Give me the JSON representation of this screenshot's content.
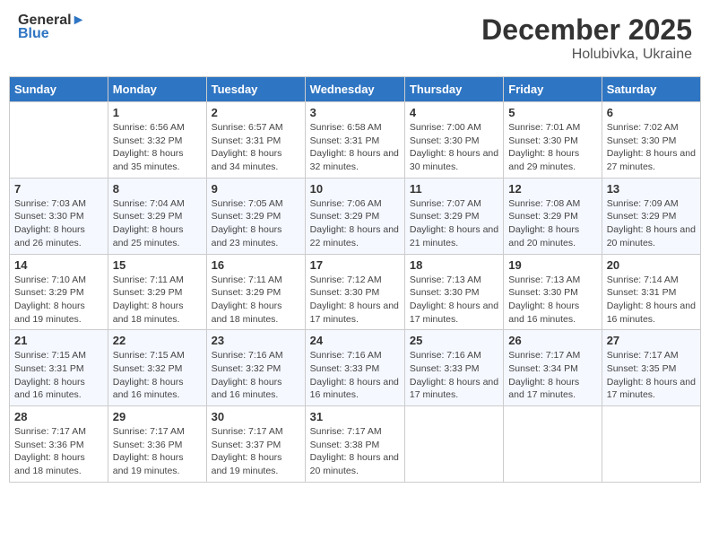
{
  "header": {
    "logo_line1": "General",
    "logo_line2": "Blue",
    "month": "December 2025",
    "location": "Holubivka, Ukraine"
  },
  "weekdays": [
    "Sunday",
    "Monday",
    "Tuesday",
    "Wednesday",
    "Thursday",
    "Friday",
    "Saturday"
  ],
  "weeks": [
    [
      {
        "day": "",
        "sunrise": "",
        "sunset": "",
        "daylight": ""
      },
      {
        "day": "1",
        "sunrise": "Sunrise: 6:56 AM",
        "sunset": "Sunset: 3:32 PM",
        "daylight": "Daylight: 8 hours and 35 minutes."
      },
      {
        "day": "2",
        "sunrise": "Sunrise: 6:57 AM",
        "sunset": "Sunset: 3:31 PM",
        "daylight": "Daylight: 8 hours and 34 minutes."
      },
      {
        "day": "3",
        "sunrise": "Sunrise: 6:58 AM",
        "sunset": "Sunset: 3:31 PM",
        "daylight": "Daylight: 8 hours and 32 minutes."
      },
      {
        "day": "4",
        "sunrise": "Sunrise: 7:00 AM",
        "sunset": "Sunset: 3:30 PM",
        "daylight": "Daylight: 8 hours and 30 minutes."
      },
      {
        "day": "5",
        "sunrise": "Sunrise: 7:01 AM",
        "sunset": "Sunset: 3:30 PM",
        "daylight": "Daylight: 8 hours and 29 minutes."
      },
      {
        "day": "6",
        "sunrise": "Sunrise: 7:02 AM",
        "sunset": "Sunset: 3:30 PM",
        "daylight": "Daylight: 8 hours and 27 minutes."
      }
    ],
    [
      {
        "day": "7",
        "sunrise": "Sunrise: 7:03 AM",
        "sunset": "Sunset: 3:30 PM",
        "daylight": "Daylight: 8 hours and 26 minutes."
      },
      {
        "day": "8",
        "sunrise": "Sunrise: 7:04 AM",
        "sunset": "Sunset: 3:29 PM",
        "daylight": "Daylight: 8 hours and 25 minutes."
      },
      {
        "day": "9",
        "sunrise": "Sunrise: 7:05 AM",
        "sunset": "Sunset: 3:29 PM",
        "daylight": "Daylight: 8 hours and 23 minutes."
      },
      {
        "day": "10",
        "sunrise": "Sunrise: 7:06 AM",
        "sunset": "Sunset: 3:29 PM",
        "daylight": "Daylight: 8 hours and 22 minutes."
      },
      {
        "day": "11",
        "sunrise": "Sunrise: 7:07 AM",
        "sunset": "Sunset: 3:29 PM",
        "daylight": "Daylight: 8 hours and 21 minutes."
      },
      {
        "day": "12",
        "sunrise": "Sunrise: 7:08 AM",
        "sunset": "Sunset: 3:29 PM",
        "daylight": "Daylight: 8 hours and 20 minutes."
      },
      {
        "day": "13",
        "sunrise": "Sunrise: 7:09 AM",
        "sunset": "Sunset: 3:29 PM",
        "daylight": "Daylight: 8 hours and 20 minutes."
      }
    ],
    [
      {
        "day": "14",
        "sunrise": "Sunrise: 7:10 AM",
        "sunset": "Sunset: 3:29 PM",
        "daylight": "Daylight: 8 hours and 19 minutes."
      },
      {
        "day": "15",
        "sunrise": "Sunrise: 7:11 AM",
        "sunset": "Sunset: 3:29 PM",
        "daylight": "Daylight: 8 hours and 18 minutes."
      },
      {
        "day": "16",
        "sunrise": "Sunrise: 7:11 AM",
        "sunset": "Sunset: 3:29 PM",
        "daylight": "Daylight: 8 hours and 18 minutes."
      },
      {
        "day": "17",
        "sunrise": "Sunrise: 7:12 AM",
        "sunset": "Sunset: 3:30 PM",
        "daylight": "Daylight: 8 hours and 17 minutes."
      },
      {
        "day": "18",
        "sunrise": "Sunrise: 7:13 AM",
        "sunset": "Sunset: 3:30 PM",
        "daylight": "Daylight: 8 hours and 17 minutes."
      },
      {
        "day": "19",
        "sunrise": "Sunrise: 7:13 AM",
        "sunset": "Sunset: 3:30 PM",
        "daylight": "Daylight: 8 hours and 16 minutes."
      },
      {
        "day": "20",
        "sunrise": "Sunrise: 7:14 AM",
        "sunset": "Sunset: 3:31 PM",
        "daylight": "Daylight: 8 hours and 16 minutes."
      }
    ],
    [
      {
        "day": "21",
        "sunrise": "Sunrise: 7:15 AM",
        "sunset": "Sunset: 3:31 PM",
        "daylight": "Daylight: 8 hours and 16 minutes."
      },
      {
        "day": "22",
        "sunrise": "Sunrise: 7:15 AM",
        "sunset": "Sunset: 3:32 PM",
        "daylight": "Daylight: 8 hours and 16 minutes."
      },
      {
        "day": "23",
        "sunrise": "Sunrise: 7:16 AM",
        "sunset": "Sunset: 3:32 PM",
        "daylight": "Daylight: 8 hours and 16 minutes."
      },
      {
        "day": "24",
        "sunrise": "Sunrise: 7:16 AM",
        "sunset": "Sunset: 3:33 PM",
        "daylight": "Daylight: 8 hours and 16 minutes."
      },
      {
        "day": "25",
        "sunrise": "Sunrise: 7:16 AM",
        "sunset": "Sunset: 3:33 PM",
        "daylight": "Daylight: 8 hours and 17 minutes."
      },
      {
        "day": "26",
        "sunrise": "Sunrise: 7:17 AM",
        "sunset": "Sunset: 3:34 PM",
        "daylight": "Daylight: 8 hours and 17 minutes."
      },
      {
        "day": "27",
        "sunrise": "Sunrise: 7:17 AM",
        "sunset": "Sunset: 3:35 PM",
        "daylight": "Daylight: 8 hours and 17 minutes."
      }
    ],
    [
      {
        "day": "28",
        "sunrise": "Sunrise: 7:17 AM",
        "sunset": "Sunset: 3:36 PM",
        "daylight": "Daylight: 8 hours and 18 minutes."
      },
      {
        "day": "29",
        "sunrise": "Sunrise: 7:17 AM",
        "sunset": "Sunset: 3:36 PM",
        "daylight": "Daylight: 8 hours and 19 minutes."
      },
      {
        "day": "30",
        "sunrise": "Sunrise: 7:17 AM",
        "sunset": "Sunset: 3:37 PM",
        "daylight": "Daylight: 8 hours and 19 minutes."
      },
      {
        "day": "31",
        "sunrise": "Sunrise: 7:17 AM",
        "sunset": "Sunset: 3:38 PM",
        "daylight": "Daylight: 8 hours and 20 minutes."
      },
      {
        "day": "",
        "sunrise": "",
        "sunset": "",
        "daylight": ""
      },
      {
        "day": "",
        "sunrise": "",
        "sunset": "",
        "daylight": ""
      },
      {
        "day": "",
        "sunrise": "",
        "sunset": "",
        "daylight": ""
      }
    ]
  ]
}
